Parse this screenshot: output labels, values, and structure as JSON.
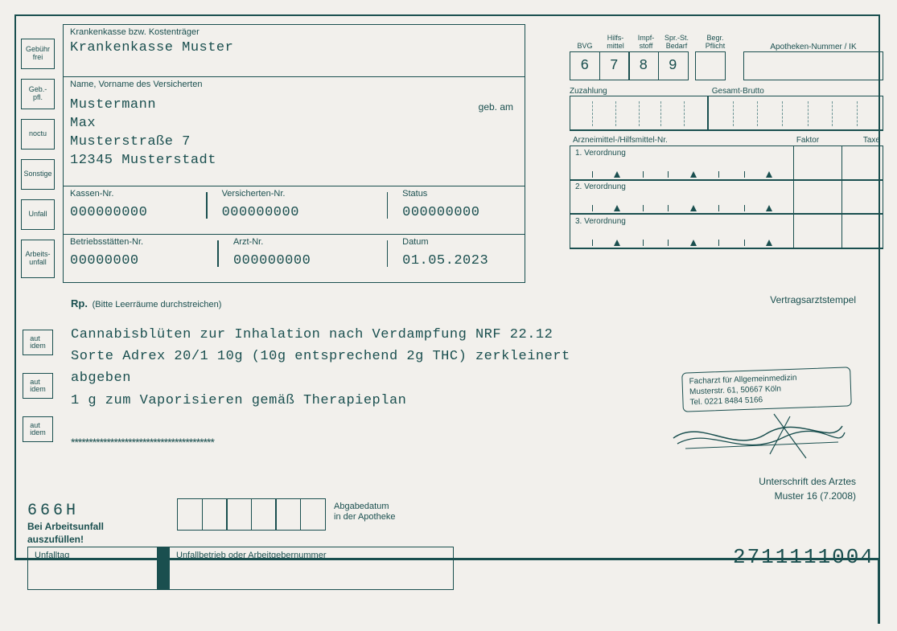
{
  "left_checkboxes": [
    "Gebühr\nfrei",
    "Geb.-\npfl.",
    "noctu",
    "Sonstige",
    "Unfall",
    "Arbeits-\nunfall"
  ],
  "insurer": {
    "label": "Krankenkasse bzw. Kostenträger",
    "value": "Krankenkasse Muster"
  },
  "patient": {
    "label": "Name, Vorname des Versicherten",
    "surname": "Mustermann",
    "firstname": "Max",
    "street": "Musterstraße 7",
    "city": "12345 Musterstadt",
    "dob_label": "geb. am"
  },
  "ids1": {
    "kassen_label": "Kassen-Nr.",
    "kassen": "000000000",
    "vers_label": "Versicherten-Nr.",
    "vers": "000000000",
    "status_label": "Status",
    "status": "000000000"
  },
  "ids2": {
    "betrieb_label": "Betriebsstätten-Nr.",
    "betrieb": "00000000",
    "arzt_label": "Arzt-Nr.",
    "arzt": "000000000",
    "datum_label": "Datum",
    "datum": "01.05.2023"
  },
  "codes": {
    "headers": [
      "BVG",
      "Hilfs-\nmittel",
      "Impf-\nstoff",
      "Spr.-St.\nBedarf",
      "Begr.\nPflicht"
    ],
    "values": [
      "6",
      "7",
      "8",
      "9",
      ""
    ],
    "apotheke_label": "Apotheken-Nummer / IK"
  },
  "payments": {
    "zuzahlung": "Zuzahlung",
    "brutto": "Gesamt-Brutto"
  },
  "medheader": {
    "arznei": "Arzneimittel-/Hilfsmittel-Nr.",
    "faktor": "Faktor",
    "taxe": "Taxe"
  },
  "medrows": [
    "1. Verordnung",
    "2. Verordnung",
    "3. Verordnung"
  ],
  "rp": {
    "prefix": "Rp.",
    "hint": "(Bitte Leerräume durchstreichen)",
    "lines": [
      "Cannabisblüten zur Inhalation nach Verdampfung NRF 22.12",
      "Sorte Adrex 20/1 10g (10g entsprechend 2g THC) zerkleinert abgeben",
      "1 g zum Vaporisieren gemäß Therapieplan"
    ],
    "stars": "****************************************"
  },
  "aut_idem": "aut\nidem",
  "footer": {
    "code": "666H",
    "line1": "Bei Arbeitsunfall",
    "line2": "auszufüllen!",
    "abgabe": "Abgabedatum\nin der Apotheke",
    "unfalltag": "Unfalltag",
    "unfallbetrieb": "Unfallbetrieb oder Arbeitgebernummer",
    "serial": "2711111004"
  },
  "stamp": {
    "label": "Vertragsarztstempel",
    "line1": "Facharzt für Allgemeinmedizin",
    "line2": "Musterstr. 61, 50667 Köln",
    "line3": "Tel. 0221 8484 5166",
    "signature_label": "Unterschrift des Arztes",
    "muster": "Muster 16 (7.2008)"
  }
}
